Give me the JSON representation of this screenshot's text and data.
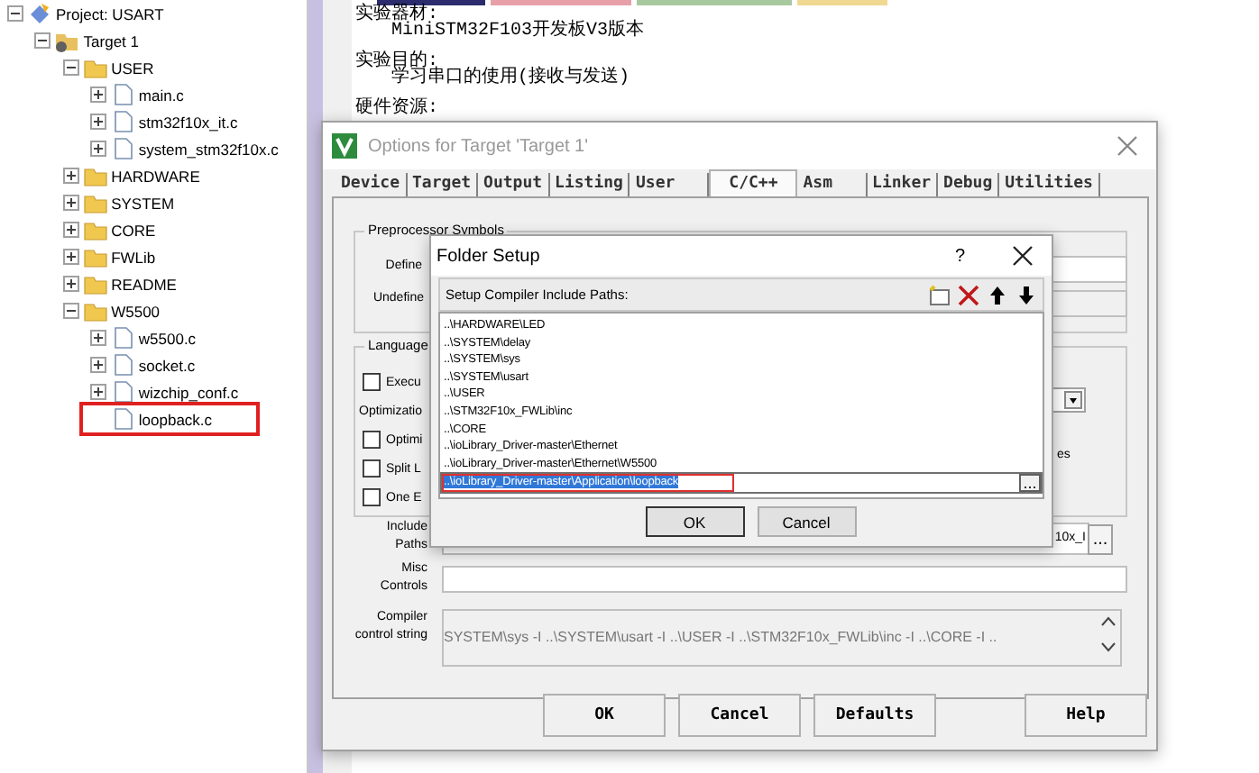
{
  "project_tree": {
    "items": [
      {
        "label": "Project: USART",
        "kind": "project",
        "expanded": true,
        "children": [
          {
            "label": "Target 1",
            "kind": "target",
            "expanded": true,
            "children": [
              {
                "label": "USER",
                "kind": "folder",
                "expanded": true,
                "children": [
                  {
                    "label": "main.c",
                    "kind": "file",
                    "expandable": true,
                    "highlighted": false
                  },
                  {
                    "label": "stm32f10x_it.c",
                    "kind": "file",
                    "expandable": true,
                    "highlighted": false
                  },
                  {
                    "label": "system_stm32f10x.c",
                    "kind": "file",
                    "expandable": true,
                    "highlighted": false
                  }
                ]
              },
              {
                "label": "HARDWARE",
                "kind": "folder",
                "expanded": false
              },
              {
                "label": "SYSTEM",
                "kind": "folder",
                "expanded": false
              },
              {
                "label": "CORE",
                "kind": "folder",
                "expanded": false
              },
              {
                "label": "FWLib",
                "kind": "folder",
                "expanded": false
              },
              {
                "label": "README",
                "kind": "folder",
                "expanded": false
              },
              {
                "label": "W5500",
                "kind": "folder",
                "expanded": true,
                "children": [
                  {
                    "label": "w5500.c",
                    "kind": "file",
                    "expandable": true,
                    "highlighted": false
                  },
                  {
                    "label": "socket.c",
                    "kind": "file",
                    "expandable": true,
                    "highlighted": false
                  },
                  {
                    "label": "wizchip_conf.c",
                    "kind": "file",
                    "expandable": true,
                    "highlighted": false
                  },
                  {
                    "label": "loopback.c",
                    "kind": "file",
                    "expandable": false,
                    "highlighted": true
                  }
                ]
              }
            ]
          }
        ]
      }
    ]
  },
  "editor": {
    "tabs": [
      {
        "color": "#2b2b6e"
      },
      {
        "color": "#e8a0a8"
      },
      {
        "color": "#a8c8a0"
      },
      {
        "color": "#f0d890"
      }
    ],
    "lines": [
      {
        "text": "实验器材:",
        "kind": "heading"
      },
      {
        "text": "MiniSTM32F103开发板V3版本",
        "kind": "detail"
      },
      {
        "text": "实验目的:",
        "kind": "heading"
      },
      {
        "text": "学习串口的使用(接收与发送)",
        "kind": "detail"
      },
      {
        "text": "硬件资源:",
        "kind": "heading"
      }
    ]
  },
  "options_dialog": {
    "title": "Options for Target 'Target 1'",
    "tabs": [
      {
        "label": "Device",
        "selected": false
      },
      {
        "label": "Target",
        "selected": false
      },
      {
        "label": "Output",
        "selected": false
      },
      {
        "label": "Listing",
        "selected": false
      },
      {
        "label": "User",
        "selected": false
      },
      {
        "label": "C/C++",
        "selected": true
      },
      {
        "label": "Asm",
        "selected": false
      },
      {
        "label": "Linker",
        "selected": false
      },
      {
        "label": "Debug",
        "selected": false
      },
      {
        "label": "Utilities",
        "selected": false
      }
    ],
    "preprocessor": {
      "title": "Preprocessor Symbols",
      "define_label": "Define",
      "undefine_label": "Undefine"
    },
    "language": {
      "title": "Language",
      "rows": [
        {
          "kind": "checkbox",
          "label": "Execu",
          "checked": false
        },
        {
          "kind": "label",
          "label": "Optimizatio"
        },
        {
          "kind": "checkbox",
          "label": "Optimi",
          "checked": false
        },
        {
          "kind": "checkbox",
          "label": "Split L",
          "checked": false
        },
        {
          "kind": "checkbox",
          "label": "One E",
          "checked": false
        }
      ],
      "right_fragment": "es"
    },
    "include_paths": {
      "label": "Include Paths",
      "value": "10x_I",
      "browse": "..."
    },
    "misc_controls": {
      "label": "Misc Controls"
    },
    "compiler_string": {
      "label": "Compiler control string",
      "value": "SYSTEM\\sys -I ..\\SYSTEM\\usart -I ..\\USER -I ..\\STM32F10x_FWLib\\inc -I ..\\CORE -I .."
    },
    "buttons": [
      {
        "label": "OK"
      },
      {
        "label": "Cancel"
      },
      {
        "label": "Defaults"
      },
      {
        "label": "Help"
      }
    ]
  },
  "folder_dialog": {
    "title": "Folder Setup",
    "help": "?",
    "header": "Setup Compiler Include Paths:",
    "paths": [
      {
        "text": "..\\HARDWARE\\LED",
        "selected": false
      },
      {
        "text": "..\\SYSTEM\\delay",
        "selected": false
      },
      {
        "text": "..\\SYSTEM\\sys",
        "selected": false
      },
      {
        "text": "..\\SYSTEM\\usart",
        "selected": false
      },
      {
        "text": "..\\USER",
        "selected": false
      },
      {
        "text": "..\\STM32F10x_FWLib\\inc",
        "selected": false
      },
      {
        "text": "..\\CORE",
        "selected": false
      },
      {
        "text": "..\\ioLibrary_Driver-master\\Ethernet",
        "selected": false
      },
      {
        "text": "..\\ioLibrary_Driver-master\\Ethernet\\W5500",
        "selected": false
      },
      {
        "text": "..\\ioLibrary_Driver-master\\Application\\loopback",
        "selected": true
      }
    ],
    "browse": "...",
    "buttons": [
      {
        "label": "OK",
        "default": true
      },
      {
        "label": "Cancel",
        "default": false
      }
    ]
  }
}
